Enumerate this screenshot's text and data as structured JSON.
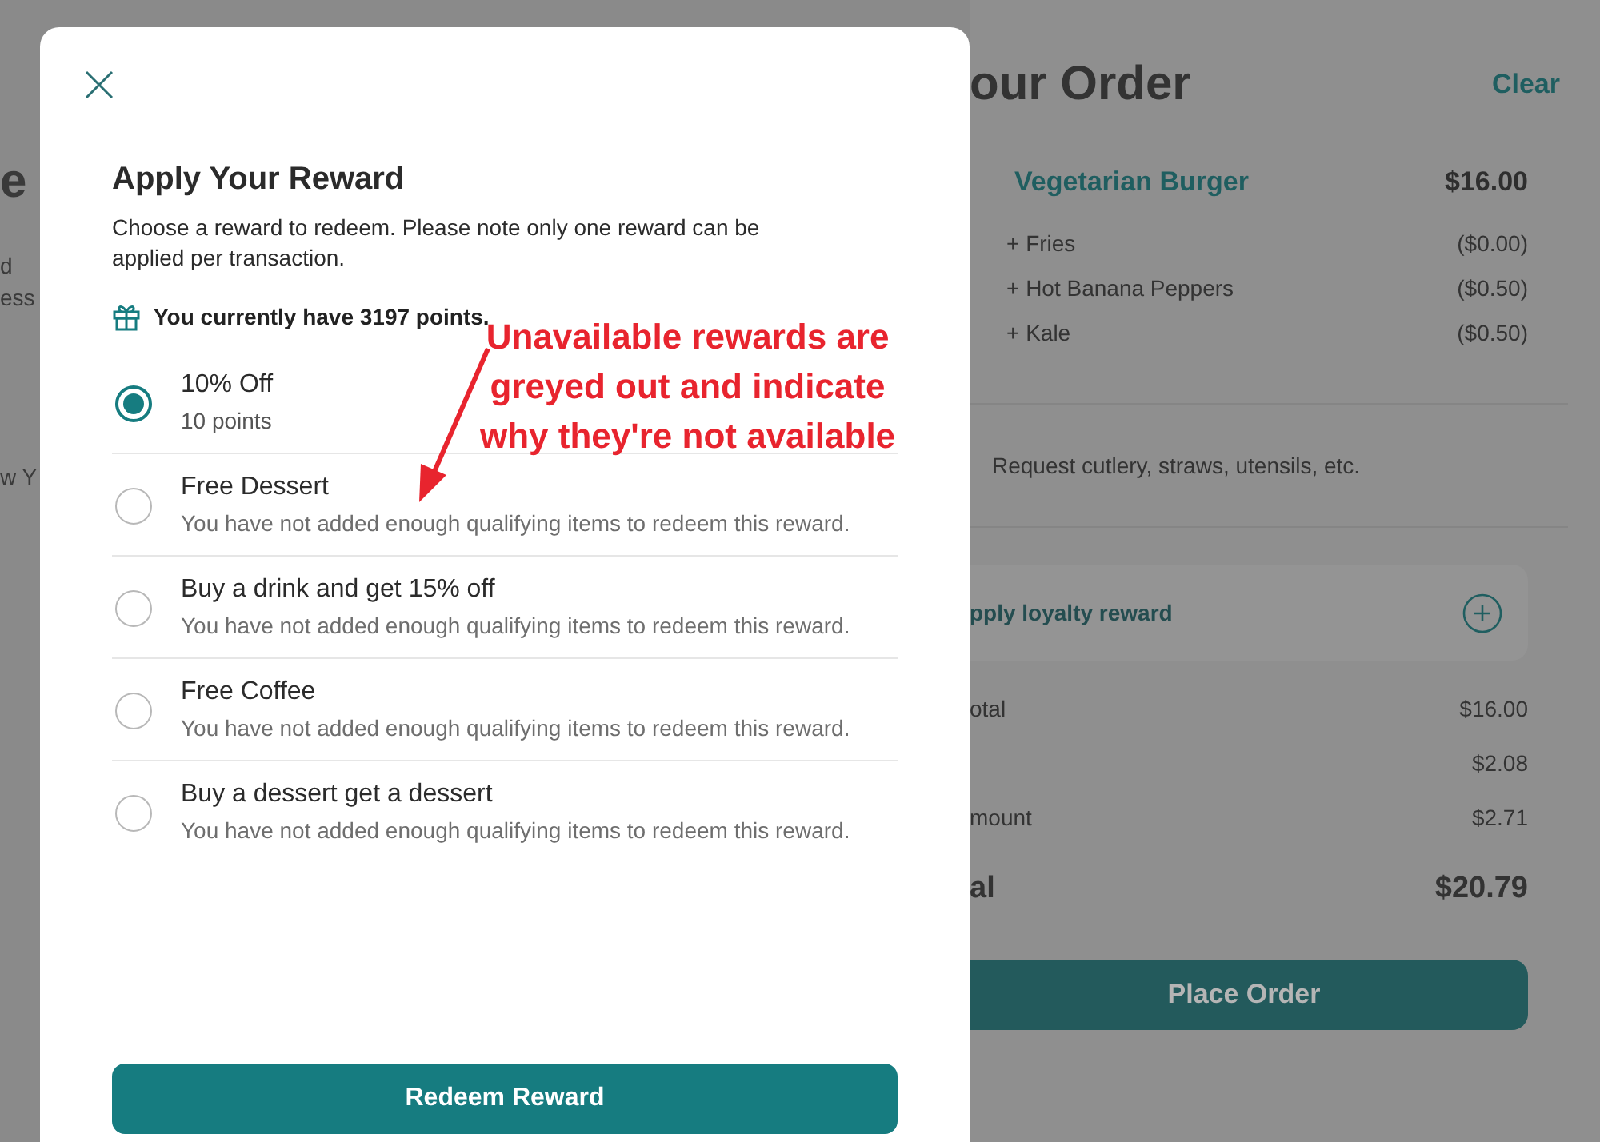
{
  "background_page": {
    "fragments": [
      "e",
      "d",
      "ess",
      "w Y"
    ]
  },
  "order": {
    "title": "our Order",
    "clear": "Clear",
    "item": {
      "name": "Vegetarian Burger",
      "price": "$16.00",
      "modifiers": [
        {
          "name": "+ Fries",
          "price": "($0.00)"
        },
        {
          "name": "+ Hot Banana Peppers",
          "price": "($0.50)"
        },
        {
          "name": "+ Kale",
          "price": "($0.50)"
        }
      ]
    },
    "note": "Request cutlery, straws, utensils, etc.",
    "loyalty": "pply loyalty reward",
    "totals": [
      {
        "label": "otal",
        "value": "$16.00"
      },
      {
        "value": "$2.08"
      },
      {
        "label": "mount",
        "value": "$2.71"
      }
    ],
    "total": {
      "label": "al",
      "value": "$20.79"
    },
    "place_order": "Place Order"
  },
  "modal": {
    "title": "Apply Your Reward",
    "description": "Choose a reward to redeem. Please note only one reward can be applied per transaction.",
    "points": "You currently have 3197 points.",
    "rewards": [
      {
        "name": "10% Off",
        "detail": "10 points",
        "selected": true,
        "available": true
      },
      {
        "name": "Free Dessert",
        "detail": "You have not added enough qualifying items to redeem this reward.",
        "selected": false,
        "available": false
      },
      {
        "name": "Buy a drink and get 15% off",
        "detail": "You have not added enough qualifying items to redeem this reward.",
        "selected": false,
        "available": false
      },
      {
        "name": "Free Coffee",
        "detail": "You have not added enough qualifying items to redeem this reward.",
        "selected": false,
        "available": false
      },
      {
        "name": "Buy a dessert get a dessert",
        "detail": "You have not added enough qualifying items to redeem this reward.",
        "selected": false,
        "available": false
      }
    ],
    "button": "Redeem Reward"
  },
  "annotation": {
    "lines": [
      "Unavailable rewards are",
      "greyed out and indicate",
      "why they're not available"
    ]
  }
}
